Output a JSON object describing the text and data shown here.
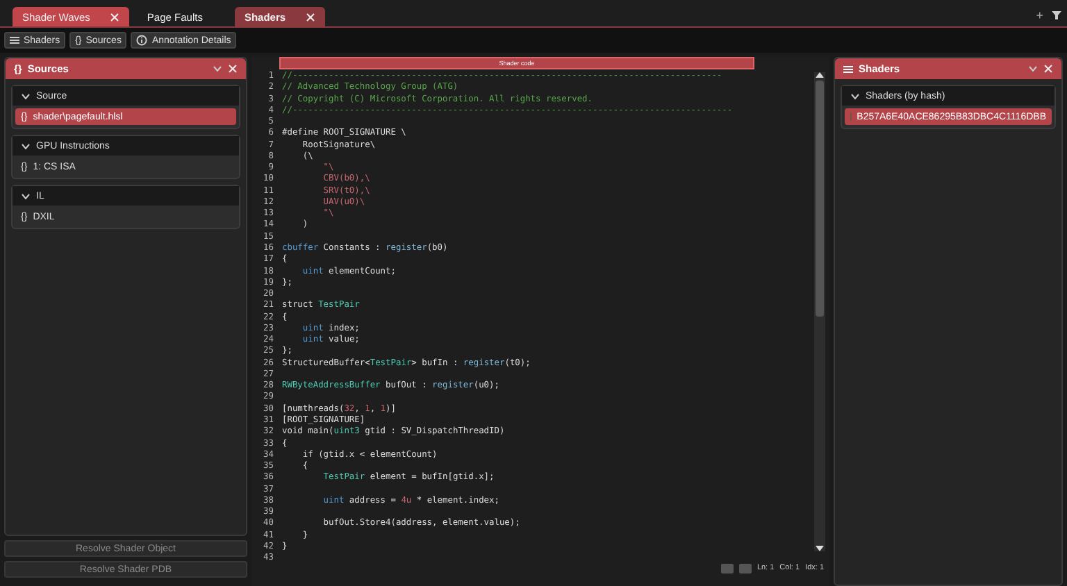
{
  "tabs": [
    {
      "label": "Shader Waves",
      "color": "#c0464c",
      "closable": true,
      "selected": false
    },
    {
      "label": "Page Faults",
      "color": "#1e1e1e",
      "closable": false,
      "selected": false
    },
    {
      "label": "Shaders",
      "color": "#8a3a3e",
      "closable": true,
      "selected": true
    }
  ],
  "tab_actions": [
    "+"
  ],
  "toolbar": [
    {
      "label": "Shaders",
      "kind": "list"
    },
    {
      "label": "Sources",
      "kind": "braces",
      "glyph": "{}"
    },
    {
      "label": "Annotation Details",
      "kind": "info"
    }
  ],
  "left_panel": {
    "icon": "{}",
    "title": "Sources",
    "sections": [
      {
        "title": "Source",
        "expanded": true,
        "items": [
          {
            "icon": "{}",
            "label": "shader\\pagefault.hlsl",
            "selected": true
          }
        ]
      },
      {
        "title": "GPU Instructions",
        "expanded": true,
        "items": [
          {
            "icon": "{}",
            "label": "1: CS ISA",
            "selected": false
          }
        ]
      },
      {
        "title": "IL",
        "expanded": true,
        "items": [
          {
            "icon": "{}",
            "label": "DXIL",
            "selected": false
          }
        ]
      }
    ],
    "buttons": [
      {
        "label": "Resolve Shader Object",
        "disabled": true
      },
      {
        "label": "Resolve Shader PDB",
        "disabled": true
      }
    ]
  },
  "code_view": {
    "title": "Shader code",
    "lines": [
      {
        "no": "1",
        "tokens": [
          {
            "kind": "comment",
            "t": "//-----------------------------------------------------------------------------------"
          }
        ]
      },
      {
        "no": "2",
        "tokens": [
          {
            "kind": "comment",
            "t": "// Advanced Technology Group (ATG)"
          }
        ]
      },
      {
        "no": "3",
        "tokens": [
          {
            "kind": "comment",
            "t": "// Copyright (C) Microsoft Corporation. All rights reserved."
          }
        ]
      },
      {
        "no": "4",
        "tokens": [
          {
            "kind": "comment",
            "t": "//-------------------------------------------------------------------------------------"
          }
        ]
      },
      {
        "no": "5"
      },
      {
        "no": "6",
        "tokens": [
          {
            "kind": "plain",
            "t": "#define ROOT_SIGNATURE \\"
          }
        ]
      },
      {
        "no": "7",
        "tokens": [
          {
            "kind": "plain",
            "t": "    RootSignature\\"
          }
        ]
      },
      {
        "no": "8",
        "tokens": [
          {
            "kind": "plain",
            "t": "    (\\"
          }
        ]
      },
      {
        "no": "9",
        "tokens": [
          {
            "kind": "string",
            "t": "        \"\\"
          }
        ]
      },
      {
        "no": "10",
        "tokens": [
          {
            "kind": "string",
            "t": "        CBV(b0),\\"
          }
        ]
      },
      {
        "no": "11",
        "tokens": [
          {
            "kind": "string",
            "t": "        SRV(t0),\\"
          }
        ]
      },
      {
        "no": "12",
        "tokens": [
          {
            "kind": "string",
            "t": "        UAV(u0)\\"
          }
        ]
      },
      {
        "no": "13",
        "tokens": [
          {
            "kind": "string",
            "t": "        \"\\"
          }
        ]
      },
      {
        "no": "14",
        "tokens": [
          {
            "kind": "plain",
            "t": "    )"
          }
        ]
      },
      {
        "no": "15"
      },
      {
        "no": "16",
        "tokens": [
          {
            "kind": "keyword",
            "t": "cbuffer"
          },
          {
            "kind": "plain",
            "t": " Constants : "
          },
          {
            "kind": "function",
            "t": "register"
          },
          {
            "kind": "plain",
            "t": "(b0)"
          }
        ]
      },
      {
        "no": "17",
        "tokens": [
          {
            "kind": "plain",
            "t": "{"
          }
        ]
      },
      {
        "no": "18",
        "tokens": [
          {
            "kind": "keyword",
            "t": "    uint"
          },
          {
            "kind": "plain",
            "t": " elementCount;"
          }
        ]
      },
      {
        "no": "19",
        "tokens": [
          {
            "kind": "plain",
            "t": "};"
          }
        ]
      },
      {
        "no": "20"
      },
      {
        "no": "21",
        "tokens": [
          {
            "kind": "plain",
            "t": "struct "
          },
          {
            "kind": "type",
            "t": "TestPair"
          }
        ]
      },
      {
        "no": "22",
        "tokens": [
          {
            "kind": "plain",
            "t": "{"
          }
        ]
      },
      {
        "no": "23",
        "tokens": [
          {
            "kind": "keyword",
            "t": "    uint"
          },
          {
            "kind": "plain",
            "t": " index;"
          }
        ]
      },
      {
        "no": "24",
        "tokens": [
          {
            "kind": "keyword",
            "t": "    uint"
          },
          {
            "kind": "plain",
            "t": " value;"
          }
        ]
      },
      {
        "no": "25",
        "tokens": [
          {
            "kind": "plain",
            "t": "};"
          }
        ]
      },
      {
        "no": "26",
        "tokens": [
          {
            "kind": "plain",
            "t": "StructuredBuffer<"
          },
          {
            "kind": "type",
            "t": "TestPair"
          },
          {
            "kind": "plain",
            "t": "> bufIn : "
          },
          {
            "kind": "function",
            "t": "register"
          },
          {
            "kind": "plain",
            "t": "(t0);"
          }
        ]
      },
      {
        "no": "27"
      },
      {
        "no": "28",
        "tokens": [
          {
            "kind": "type",
            "t": "RWByteAddressBuffer"
          },
          {
            "kind": "plain",
            "t": " bufOut : "
          },
          {
            "kind": "function",
            "t": "register"
          },
          {
            "kind": "plain",
            "t": "(u0);"
          }
        ]
      },
      {
        "no": "29"
      },
      {
        "no": "30",
        "tokens": [
          {
            "kind": "plain",
            "t": "[numthreads("
          },
          {
            "kind": "number",
            "t": "32"
          },
          {
            "kind": "plain",
            "t": ", "
          },
          {
            "kind": "number",
            "t": "1"
          },
          {
            "kind": "plain",
            "t": ", "
          },
          {
            "kind": "number",
            "t": "1"
          },
          {
            "kind": "plain",
            "t": ")]"
          }
        ]
      },
      {
        "no": "31",
        "tokens": [
          {
            "kind": "plain",
            "t": "[ROOT_SIGNATURE]"
          }
        ]
      },
      {
        "no": "32",
        "tokens": [
          {
            "kind": "plain",
            "t": "void main("
          },
          {
            "kind": "type",
            "t": "uint3"
          },
          {
            "kind": "plain",
            "t": " gtid : SV_DispatchThreadID)"
          }
        ]
      },
      {
        "no": "33",
        "tokens": [
          {
            "kind": "plain",
            "t": "{"
          }
        ]
      },
      {
        "no": "34",
        "tokens": [
          {
            "kind": "plain",
            "t": "    if (gtid.x < elementCount)"
          }
        ]
      },
      {
        "no": "35",
        "tokens": [
          {
            "kind": "plain",
            "t": "    {"
          }
        ]
      },
      {
        "no": "36",
        "tokens": [
          {
            "kind": "type",
            "t": "        TestPair"
          },
          {
            "kind": "plain",
            "t": " element = bufIn[gtid.x];"
          }
        ]
      },
      {
        "no": "37"
      },
      {
        "no": "38",
        "tokens": [
          {
            "kind": "keyword",
            "t": "        uint"
          },
          {
            "kind": "plain",
            "t": " address = "
          },
          {
            "kind": "number",
            "t": "4u"
          },
          {
            "kind": "plain",
            "t": " * element.index;"
          }
        ]
      },
      {
        "no": "39"
      },
      {
        "no": "40",
        "tokens": [
          {
            "kind": "plain",
            "t": "        bufOut.Store4(address, element.value);"
          }
        ]
      },
      {
        "no": "41",
        "tokens": [
          {
            "kind": "plain",
            "t": "    }"
          }
        ]
      },
      {
        "no": "42",
        "tokens": [
          {
            "kind": "plain",
            "t": "}"
          }
        ]
      },
      {
        "no": "43"
      }
    ],
    "status": [
      "Ln: 1",
      "Col: 1",
      "Idx: 1"
    ]
  },
  "right_panel": {
    "title": "Shaders",
    "sections": [
      {
        "title": "Shaders (by hash)",
        "expanded": true,
        "items": [
          {
            "label": "B257A6E40ACE86295B83DBC4C1116DBB",
            "selected": true
          }
        ]
      }
    ]
  }
}
